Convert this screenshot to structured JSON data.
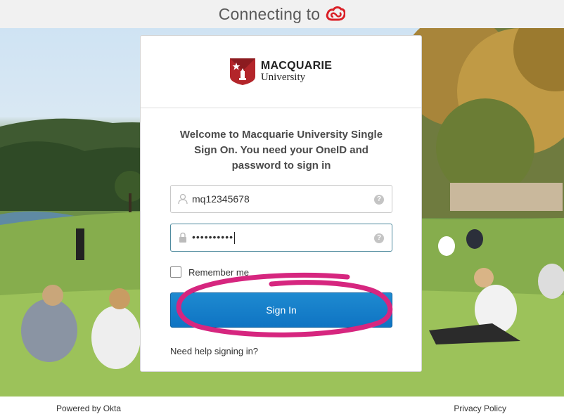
{
  "header": {
    "title": "Connecting to",
    "logo_icon": "adobe-creative-cloud-icon",
    "logo_color": "#da1f26"
  },
  "logo": {
    "line1": "MACQUARIE",
    "line2": "University",
    "crest_color": "#b3252a"
  },
  "form": {
    "welcome": "Welcome to Macquarie University Single Sign On. You need your OneID and password to sign in",
    "username_value": "mq12345678",
    "password_value": "••••••••••",
    "help_glyph": "?",
    "remember_label": "Remember me",
    "remember_checked": false,
    "signin_label": "Sign In",
    "help_link": "Need help signing in?"
  },
  "footer": {
    "powered_by": "Powered by Okta",
    "privacy": "Privacy Policy"
  },
  "colors": {
    "button": "#1681c9",
    "annotation": "#d6267f"
  }
}
